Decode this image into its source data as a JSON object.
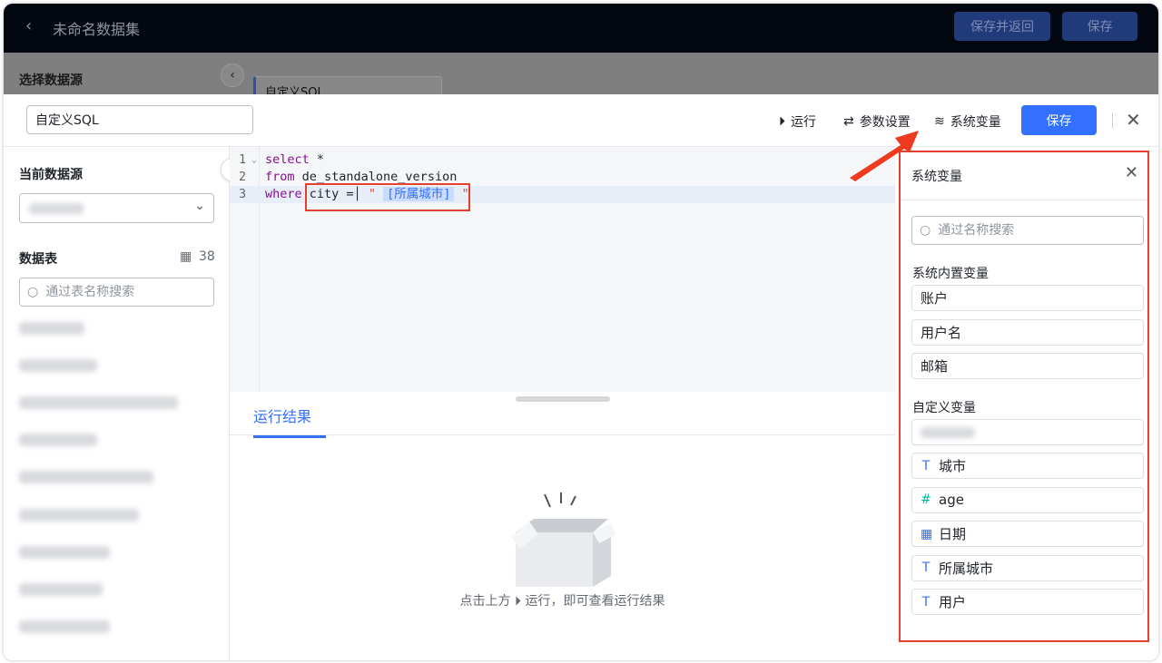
{
  "topbar": {
    "title": "未命名数据集",
    "save_return": "保存并返回",
    "save": "保存"
  },
  "background": {
    "select_source": "选择数据源",
    "tab": "自定义SQL"
  },
  "drawer": {
    "name_value": "自定义SQL",
    "toolbar": {
      "run": "运行",
      "params": "参数设置",
      "sysvars": "系统变量",
      "save": "保存"
    },
    "left": {
      "current_source": "当前数据源",
      "tables_label": "数据表",
      "table_count": "38",
      "table_search_placeholder": "通过表名称搜索"
    },
    "editor": {
      "lines": [
        {
          "n": "1",
          "kw": "select",
          "rest": " *"
        },
        {
          "n": "2",
          "kw": "from",
          "rest": " de_standalone_version"
        },
        {
          "n": "3",
          "kw": "where",
          "rest": " city =",
          "q1": "\"",
          "tag": "[所属城市]",
          "q2": "\""
        }
      ]
    },
    "results": {
      "tab": "运行结果",
      "empty_prefix": "点击上方",
      "empty_suffix": "运行，即可查看运行结果"
    },
    "panel": {
      "title": "系统变量",
      "search_placeholder": "通过名称搜索",
      "builtin_label": "系统内置变量",
      "builtin": [
        "账户",
        "用户名",
        "邮箱"
      ],
      "custom_label": "自定义变量",
      "custom": [
        {
          "icon": "text-type-icon",
          "glyph": "T",
          "label": "城市",
          "color": "#3370ff"
        },
        {
          "icon": "number-type-icon",
          "glyph": "#",
          "label": "age",
          "color": "#04b49c"
        },
        {
          "icon": "date-type-icon",
          "glyph": "▦",
          "label": "日期",
          "color": "#3370ff"
        },
        {
          "icon": "text-type-icon",
          "glyph": "T",
          "label": "所属城市",
          "color": "#3370ff"
        },
        {
          "icon": "text-type-icon",
          "glyph": "T",
          "label": "用户",
          "color": "#3370ff"
        }
      ]
    }
  },
  "colors": {
    "accent": "#3370ff",
    "highlight": "#e5402f"
  }
}
